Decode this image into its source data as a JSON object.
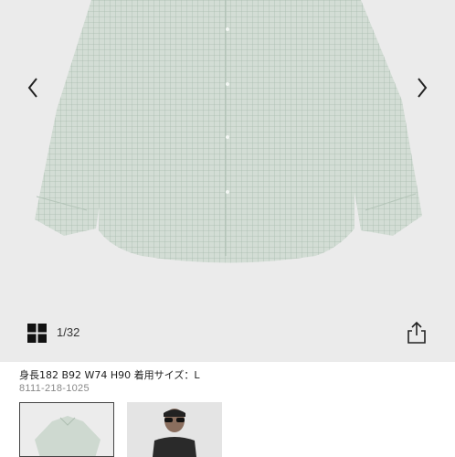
{
  "gallery": {
    "counter": "1/32",
    "background_color": "#ebebeb",
    "shirt_color": "#c9d6cc",
    "icons": {
      "prev": "chevron-left-icon",
      "next": "chevron-right-icon",
      "grid": "grid-view-icon",
      "share": "share-icon"
    }
  },
  "product": {
    "model_info": "身長182 B92 W74 H90 着用サイズ：L",
    "code": "8111-218-1025"
  },
  "thumbnails": [
    {
      "label": "shirt-flat-lay",
      "selected": true
    },
    {
      "label": "model-wearing-shirt",
      "selected": false
    }
  ]
}
